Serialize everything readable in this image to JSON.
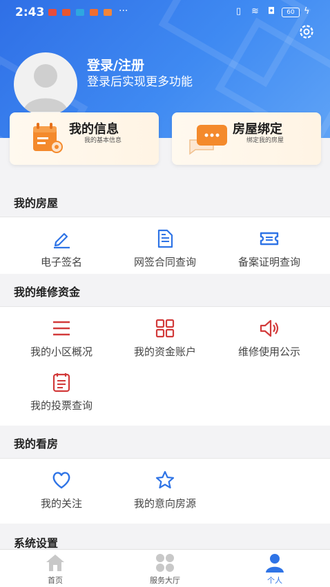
{
  "status_bar": {
    "time": "2:43",
    "more": "···",
    "battery": "60"
  },
  "profile": {
    "login_title": "登录/注册",
    "login_subtitle": "登录后实现更多功能"
  },
  "cards": [
    {
      "title": "我的信息",
      "subtitle": "我的基本信息",
      "icon": "profile-info-icon"
    },
    {
      "title": "房屋绑定",
      "subtitle": "绑定我的房屋",
      "icon": "chat-bubble-icon"
    }
  ],
  "sections": {
    "house": {
      "title": "我的房屋",
      "items": [
        {
          "label": "电子签名",
          "icon": "pen-icon"
        },
        {
          "label": "网签合同查询",
          "icon": "document-icon"
        },
        {
          "label": "备案证明查询",
          "icon": "ticket-icon"
        }
      ]
    },
    "fund": {
      "title": "我的维修资金",
      "items": [
        {
          "label": "我的小区概况",
          "icon": "list-icon"
        },
        {
          "label": "我的资金账户",
          "icon": "grid-icon"
        },
        {
          "label": "维修使用公示",
          "icon": "speaker-icon"
        },
        {
          "label": "我的投票查询",
          "icon": "vote-list-icon"
        }
      ]
    },
    "viewing": {
      "title": "我的看房",
      "items": [
        {
          "label": "我的关注",
          "icon": "heart-icon"
        },
        {
          "label": "我的意向房源",
          "icon": "star-icon"
        }
      ]
    },
    "settings": {
      "title": "系统设置"
    }
  },
  "tabbar": [
    {
      "label": "首页",
      "icon": "home-icon"
    },
    {
      "label": "服务大厅",
      "icon": "services-icon"
    },
    {
      "label": "个人",
      "icon": "person-icon"
    }
  ],
  "colors": {
    "blue": "#2f74e6",
    "red": "#d23a3a",
    "tab_active": "#2f74e6",
    "tab_inactive": "#c8c8c8"
  }
}
